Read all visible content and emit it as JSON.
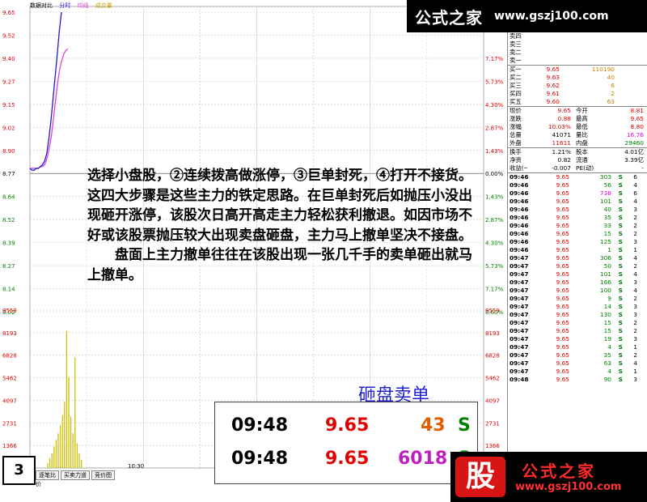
{
  "chart_top": {
    "legend": [
      "数据对比",
      "分时",
      "均线",
      "成交量"
    ],
    "legend_colors": [
      "#000000",
      "#1e1ec8",
      "#e040e0",
      "#c8a000"
    ],
    "price_ticks": [
      "9.65",
      "9.52",
      "9.40",
      "9.27",
      "9.15",
      "9.02",
      "8.90",
      "8.77",
      "8.64",
      "8.52",
      "8.39",
      "8.27",
      "8.14",
      "8.02"
    ],
    "pct_ticks": [
      "7.17%",
      "5.73%",
      "4.30%",
      "2.87%",
      "1.43%",
      "0.00%",
      "1.43%",
      "2.87%",
      "4.30%",
      "5.73%",
      "7.17%",
      "8.60%"
    ],
    "vol_ticks": [
      "9559",
      "8193",
      "6828",
      "5462",
      "4097",
      "2731",
      "1366"
    ],
    "time_label": "10:30"
  },
  "chart_data": {
    "type": "line",
    "price_series": [
      8.8,
      8.79,
      8.79,
      8.8,
      8.8,
      8.81,
      8.82,
      8.84,
      8.88,
      8.96,
      9.06,
      9.18,
      9.3,
      9.42,
      9.55,
      9.65
    ],
    "avg_series": [
      8.8,
      8.8,
      8.8,
      8.8,
      8.8,
      8.81,
      8.81,
      8.82,
      8.85,
      8.9,
      8.96,
      9.05,
      9.15,
      9.25,
      9.33,
      9.38,
      9.42,
      9.44,
      9.45
    ],
    "volume_series": [
      300,
      600,
      900,
      1300,
      1700,
      2100,
      2600,
      3200,
      4000,
      8300,
      5500,
      3100,
      2100,
      6700,
      1500,
      900,
      500
    ],
    "ylim": [
      8.02,
      9.65
    ],
    "vol_ylim": [
      0,
      9559
    ]
  },
  "top_banner": {
    "title": "公式之家",
    "url": "www.gszj100.com"
  },
  "bottom_banner": {
    "logo": "股",
    "title": "公式之家",
    "url": "www.gszj100.com"
  },
  "orderbook": {
    "sells": [
      {
        "label": "卖四",
        "price": "",
        "vol": ""
      },
      {
        "label": "卖三",
        "price": "",
        "vol": ""
      },
      {
        "label": "卖二",
        "price": "",
        "vol": ""
      },
      {
        "label": "卖一",
        "price": "",
        "vol": ""
      }
    ],
    "buys": [
      {
        "label": "买一",
        "price": "9.65",
        "vol": "110190"
      },
      {
        "label": "买二",
        "price": "9.63",
        "vol": "40"
      },
      {
        "label": "买三",
        "price": "9.62",
        "vol": "6"
      },
      {
        "label": "买四",
        "price": "9.61",
        "vol": "2"
      },
      {
        "label": "买五",
        "price": "9.60",
        "vol": "63"
      }
    ]
  },
  "quote": [
    {
      "l1": "现价",
      "v1": "9.65",
      "c1": "#e00000",
      "l2": "今开",
      "v2": "8.81",
      "c2": "#e00000"
    },
    {
      "l1": "涨跌",
      "v1": "0.88",
      "c1": "#e00000",
      "l2": "最高",
      "v2": "9.65",
      "c2": "#e00000"
    },
    {
      "l1": "涨幅",
      "v1": "10.03%",
      "c1": "#e00000",
      "l2": "最低",
      "v2": "8.80",
      "c2": "#e00000"
    },
    {
      "l1": "总量",
      "v1": "41071",
      "c1": "#000000",
      "l2": "量比",
      "v2": "16.76",
      "c2": "#e000e0"
    },
    {
      "l1": "外盘",
      "v1": "11611",
      "c1": "#e00000",
      "l2": "内盘",
      "v2": "29460",
      "c2": "#008000"
    }
  ],
  "quote2": [
    {
      "l1": "换手",
      "v1": "1.21%",
      "l2": "股本",
      "v2": "4.01亿"
    },
    {
      "l1": "净资",
      "v1": "0.82",
      "l2": "流通",
      "v2": "3.39亿"
    },
    {
      "l1": "收益(一)",
      "v1": "-0.007",
      "l2": "PE(动)",
      "v2": "-"
    }
  ],
  "trades": [
    {
      "t": "09:46",
      "p": "9.65",
      "v": "303",
      "s": "S",
      "n": "6",
      "vc": "#008000"
    },
    {
      "t": "09:46",
      "p": "9.65",
      "v": "56",
      "s": "S",
      "n": "4",
      "vc": "#008000"
    },
    {
      "t": "09:46",
      "p": "9.65",
      "v": "738",
      "s": "S",
      "n": "6",
      "vc": "#e000e0"
    },
    {
      "t": "09:46",
      "p": "9.65",
      "v": "101",
      "s": "S",
      "n": "4",
      "vc": "#008000"
    },
    {
      "t": "09:46",
      "p": "9.65",
      "v": "40",
      "s": "S",
      "n": "3",
      "vc": "#008000"
    },
    {
      "t": "09:46",
      "p": "9.65",
      "v": "35",
      "s": "S",
      "n": "2",
      "vc": "#008000"
    },
    {
      "t": "09:46",
      "p": "9.65",
      "v": "33",
      "s": "S",
      "n": "2",
      "vc": "#008000"
    },
    {
      "t": "09:46",
      "p": "9.65",
      "v": "15",
      "s": "S",
      "n": "2",
      "vc": "#008000"
    },
    {
      "t": "09:46",
      "p": "9.65",
      "v": "125",
      "s": "S",
      "n": "3",
      "vc": "#008000"
    },
    {
      "t": "09:46",
      "p": "9.65",
      "v": "1",
      "s": "S",
      "n": "1",
      "vc": "#008000"
    },
    {
      "t": "09:47",
      "p": "9.65",
      "v": "306",
      "s": "S",
      "n": "4",
      "vc": "#008000"
    },
    {
      "t": "09:47",
      "p": "9.65",
      "v": "50",
      "s": "S",
      "n": "2",
      "vc": "#008000"
    },
    {
      "t": "09:47",
      "p": "9.65",
      "v": "101",
      "s": "S",
      "n": "4",
      "vc": "#008000"
    },
    {
      "t": "09:47",
      "p": "9.65",
      "v": "166",
      "s": "S",
      "n": "3",
      "vc": "#008000"
    },
    {
      "t": "09:47",
      "p": "9.65",
      "v": "100",
      "s": "S",
      "n": "4",
      "vc": "#008000"
    },
    {
      "t": "09:47",
      "p": "9.65",
      "v": "9",
      "s": "S",
      "n": "2",
      "vc": "#008000"
    },
    {
      "t": "09:47",
      "p": "9.65",
      "v": "14",
      "s": "S",
      "n": "3",
      "vc": "#008000"
    },
    {
      "t": "09:47",
      "p": "9.65",
      "v": "130",
      "s": "S",
      "n": "3",
      "vc": "#008000"
    },
    {
      "t": "09:47",
      "p": "9.65",
      "v": "15",
      "s": "S",
      "n": "2",
      "vc": "#008000"
    },
    {
      "t": "09:47",
      "p": "9.65",
      "v": "15",
      "s": "S",
      "n": "2",
      "vc": "#008000"
    },
    {
      "t": "09:47",
      "p": "9.65",
      "v": "19",
      "s": "S",
      "n": "3",
      "vc": "#008000"
    },
    {
      "t": "09:47",
      "p": "9.65",
      "v": "4",
      "s": "S",
      "n": "1",
      "vc": "#008000"
    },
    {
      "t": "09:47",
      "p": "9.65",
      "v": "35",
      "s": "S",
      "n": "2",
      "vc": "#008000"
    },
    {
      "t": "09:47",
      "p": "9.65",
      "v": "63",
      "s": "S",
      "n": "4",
      "vc": "#008000"
    },
    {
      "t": "09:47",
      "p": "9.65",
      "v": "4",
      "s": "S",
      "n": "1",
      "vc": "#008000"
    },
    {
      "t": "09:48",
      "p": "9.65",
      "v": "90",
      "s": "S",
      "n": "3",
      "vc": "#008000"
    }
  ],
  "note": {
    "p1": "选择小盘股，②连续拨高做涨停，③巨单封死，④打开不接货。这四大步骤是这些主力的铁定思路。在巨单封死后如抛压小没出现砸开涨停，该股次日高开高走主力轻松获利撤退。如因市场不好或该股票抛压较大出现卖盘砸盘，主力马上撤单坚决不接盘。",
    "p2": "盘面上主力撤单往往在该股出现一张几千手的卖单砸出就马上撤单。"
  },
  "callout": {
    "title": "砸盘卖单",
    "rows": [
      {
        "t": "09:48",
        "p": "9.65",
        "v": "43",
        "s": "S",
        "vc": "#e06000"
      },
      {
        "t": "09:48",
        "p": "9.65",
        "v": "6018",
        "s": "S",
        "vc": "#c020c0"
      }
    ]
  },
  "page_no": "3",
  "tabs": [
    "逐笔比",
    "买卖力道",
    "竞价图"
  ],
  "tab2": "价"
}
